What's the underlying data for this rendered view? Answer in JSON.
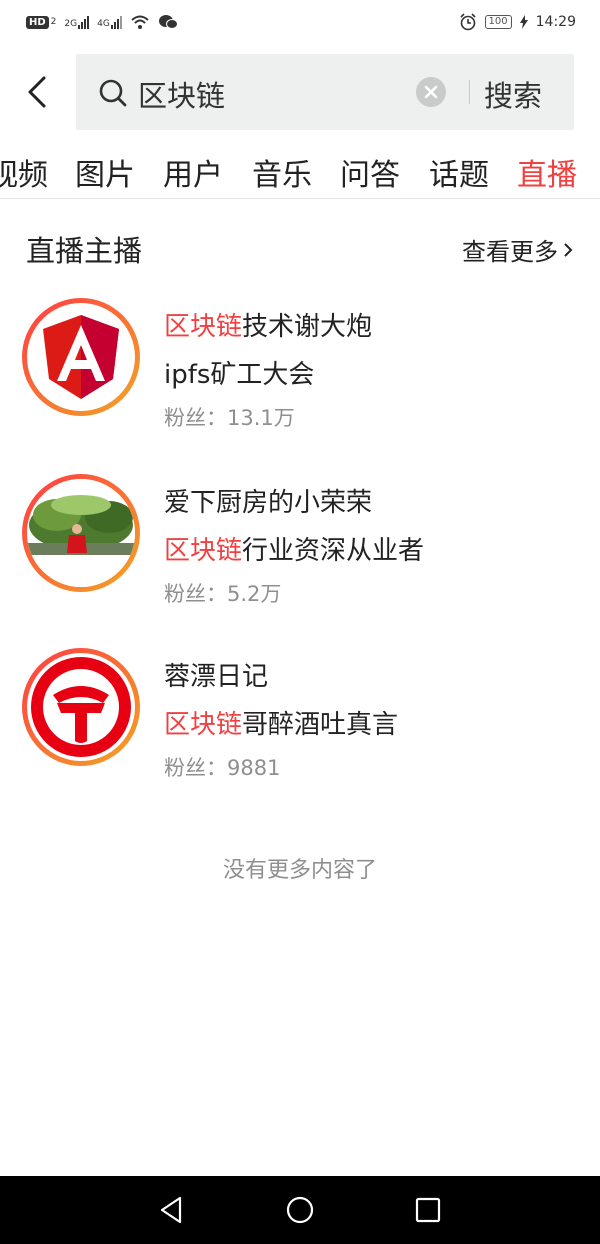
{
  "status_bar": {
    "hd_badge": "HD",
    "sim_label": "2",
    "network_1": "2G",
    "network_2": "4G",
    "battery": "100",
    "time": "14:29"
  },
  "search": {
    "query": "区块链",
    "search_button": "搜索"
  },
  "tabs": [
    {
      "label": "视频"
    },
    {
      "label": "图片"
    },
    {
      "label": "用户"
    },
    {
      "label": "音乐"
    },
    {
      "label": "问答"
    },
    {
      "label": "话题"
    },
    {
      "label": "直播",
      "active": true
    }
  ],
  "section": {
    "title": "直播主播",
    "see_more": "查看更多"
  },
  "anchors": [
    {
      "name_prefix": "区块链",
      "name_rest": "技术谢大炮",
      "desc_prefix": "",
      "desc_rest": "ipfs矿工大会",
      "fans": "粉丝：13.1万",
      "avatar_icon": "angular-logo-icon"
    },
    {
      "name_prefix": "",
      "name_rest": "爱下厨房的小荣荣",
      "desc_prefix": "区块链",
      "desc_rest": "行业资深从业者",
      "fans": "粉丝：5.2万",
      "avatar_icon": "person-photo-avatar"
    },
    {
      "name_prefix": "",
      "name_rest": "蓉漂日记",
      "desc_prefix": "区块链",
      "desc_rest": "哥醉酒吐真言",
      "fans": "粉丝：9881",
      "avatar_icon": "railway-logo-icon"
    }
  ],
  "footer_note": "没有更多内容了",
  "colors": {
    "accent": "#f04142",
    "search_bg": "#eef0ef",
    "ring_start": "#ff3b44",
    "ring_end": "#f2a624"
  }
}
